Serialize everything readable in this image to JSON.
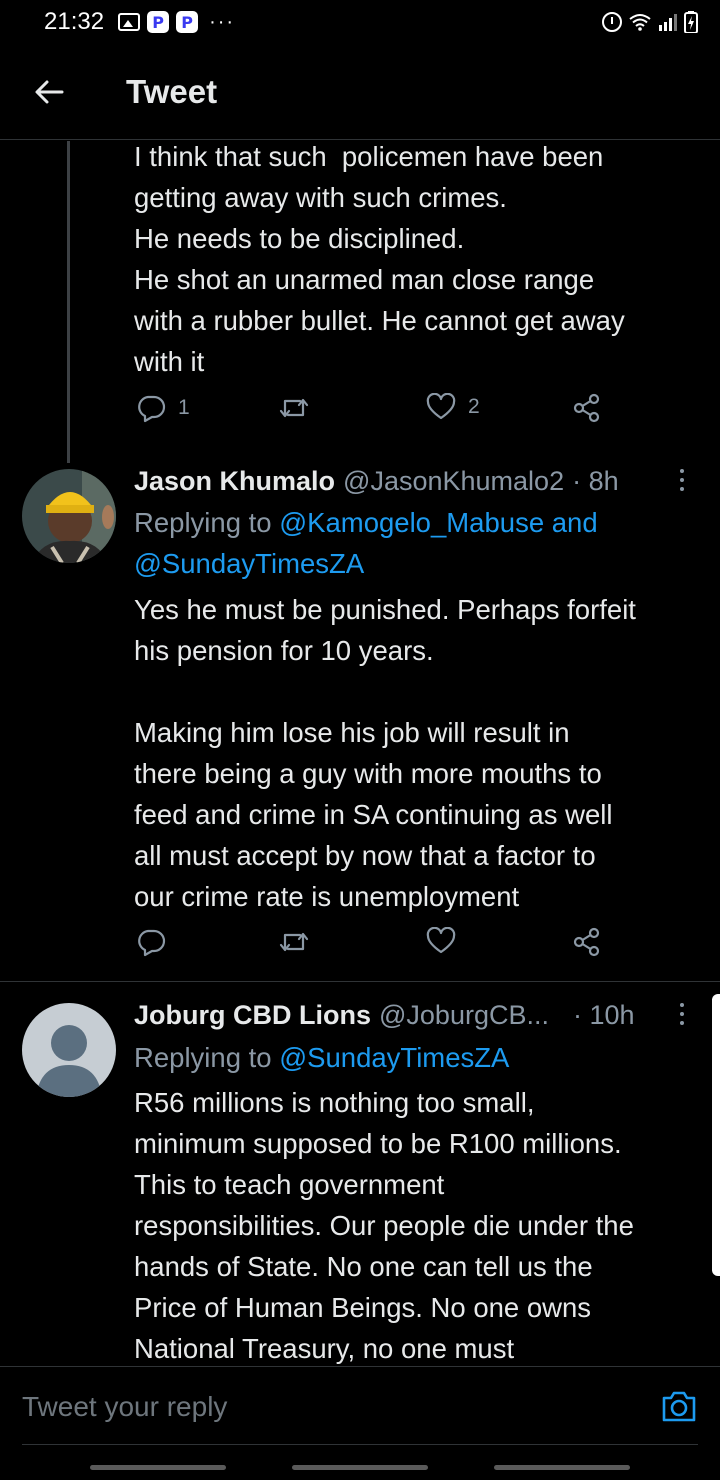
{
  "status_bar": {
    "time": "21:32",
    "notification_badge": "P",
    "more": "···"
  },
  "header": {
    "title": "Tweet"
  },
  "prev_tweet": {
    "text": "I think that such  policemen have been\ngetting away with such crimes.\nHe needs to be disciplined.\nHe shot an unarmed man close range\nwith a rubber bullet. He cannot get away\nwith it",
    "reply_count": "1",
    "like_count": "2"
  },
  "tweets": [
    {
      "author": "Jason Khumalo",
      "handle": "@JasonKhumalo2",
      "time": "· 8h",
      "replying_prefix": "Replying to ",
      "replying_line1": "@Kamogelo_Mabuse and",
      "replying_line2": "@SundayTimesZA",
      "text": "Yes he must be punished. Perhaps forfeit\nhis pension for 10 years.\n\nMaking him lose his job will result in\nthere being a guy with more mouths to\nfeed and crime in SA continuing as well\nall must accept by now that a factor to\nour crime rate is unemployment"
    },
    {
      "author": "Joburg CBD Lions",
      "handle": "@JoburgCB...",
      "time": "· 10h",
      "replying_prefix": "Replying to ",
      "replying_line1": "@SundayTimesZA",
      "text": "R56 millions is nothing too small,\nminimum supposed to be R100 millions.\nThis to teach government\nresponsibilities. Our people die under the\nhands of State. No one can tell us the\nPrice of Human Beings. No one owns\nNational Treasury, no one must"
    }
  ],
  "reply_bar": {
    "placeholder": "Tweet your reply"
  },
  "colors": {
    "background": "#000000",
    "text": "#e7e9ea",
    "muted": "#8b98a5",
    "link": "#1d9bf0",
    "divider": "#2f3336"
  },
  "icons": [
    "back-arrow-icon",
    "reply-icon",
    "retweet-icon",
    "like-icon",
    "share-icon",
    "more-icon",
    "camera-icon"
  ]
}
